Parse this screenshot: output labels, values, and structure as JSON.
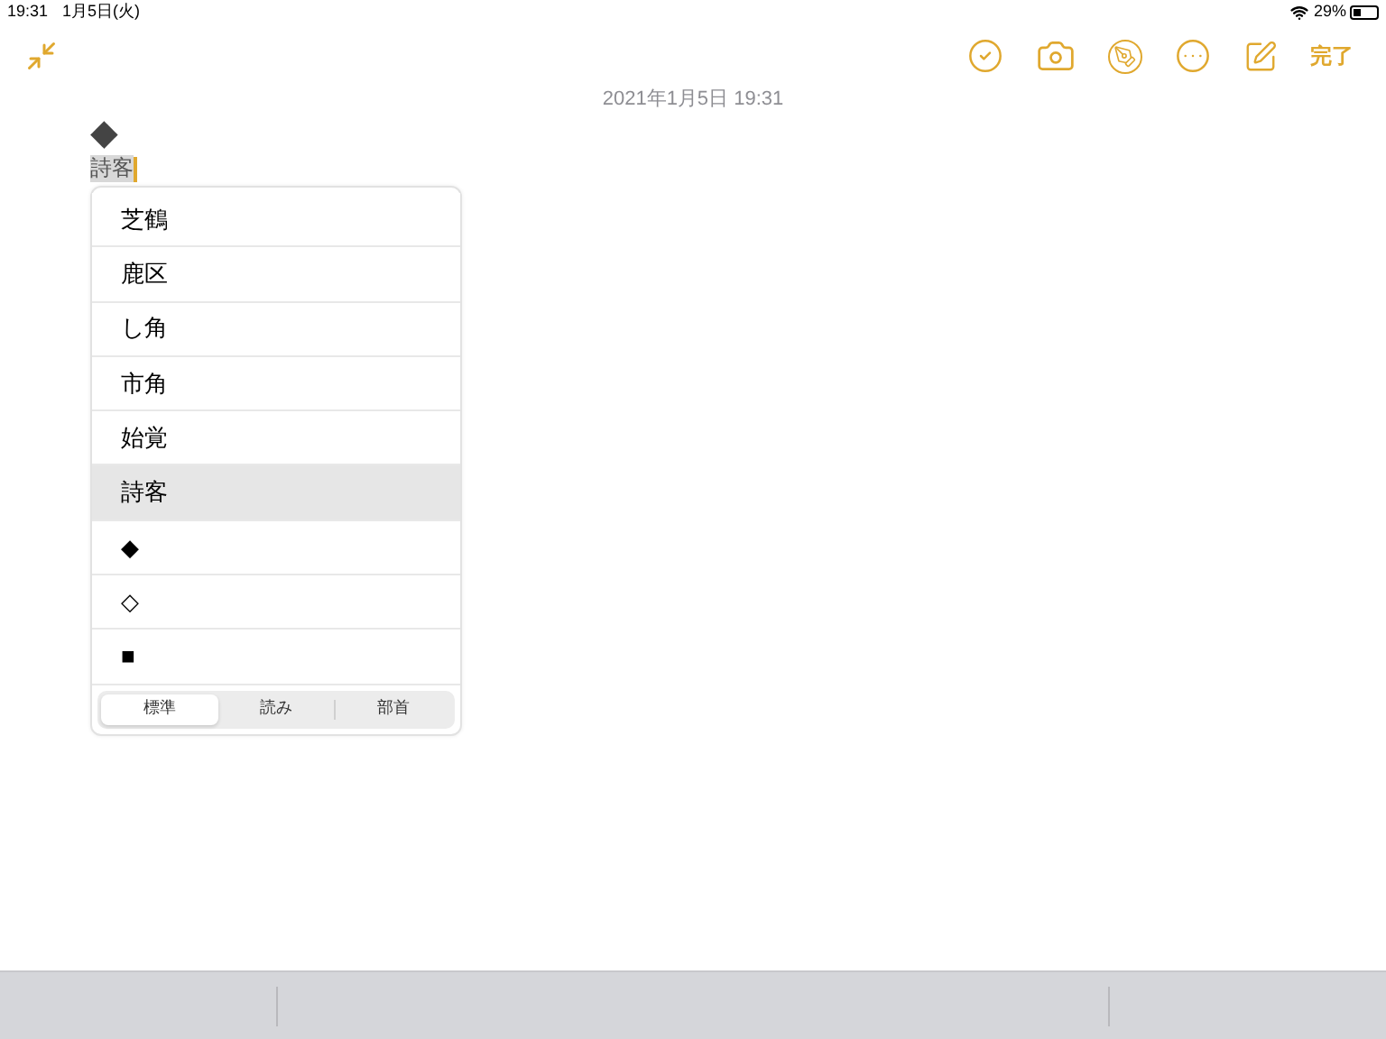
{
  "status_bar": {
    "time": "19:31",
    "date": "1月5日(火)",
    "battery": "29%"
  },
  "toolbar": {
    "done": "完了"
  },
  "note": {
    "timestamp": "2021年1月5日 19:31",
    "symbol": "◆",
    "text": "詩客"
  },
  "candidates": [
    {
      "text": "芝鶴",
      "selected": false
    },
    {
      "text": "鹿区",
      "selected": false
    },
    {
      "text": "し角",
      "selected": false
    },
    {
      "text": "市角",
      "selected": false
    },
    {
      "text": "始覚",
      "selected": false
    },
    {
      "text": "詩客",
      "selected": true
    },
    {
      "text": "◆",
      "selected": false
    },
    {
      "text": "◇",
      "selected": false
    },
    {
      "text": "■",
      "selected": false
    }
  ],
  "segments": [
    {
      "label": "標準",
      "selected": true
    },
    {
      "label": "読み",
      "selected": false
    },
    {
      "label": "部首",
      "selected": false
    }
  ]
}
